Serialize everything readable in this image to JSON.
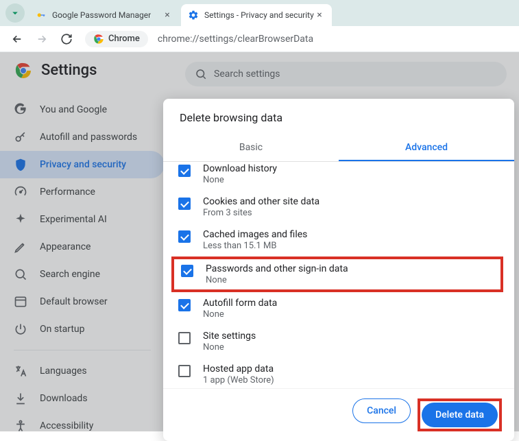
{
  "tabs": [
    {
      "title": "Google Password Manager"
    },
    {
      "title": "Settings - Privacy and security"
    }
  ],
  "addressBar": {
    "label": "Chrome",
    "url": "chrome://settings/clearBrowserData"
  },
  "settingsTitle": "Settings",
  "searchPlaceholder": "Search settings",
  "sidebar": [
    {
      "label": "You and Google"
    },
    {
      "label": "Autofill and passwords"
    },
    {
      "label": "Privacy and security"
    },
    {
      "label": "Performance"
    },
    {
      "label": "Experimental AI"
    },
    {
      "label": "Appearance"
    },
    {
      "label": "Search engine"
    },
    {
      "label": "Default browser"
    },
    {
      "label": "On startup"
    }
  ],
  "sidebarExtra": [
    {
      "label": "Languages"
    },
    {
      "label": "Downloads"
    },
    {
      "label": "Accessibility"
    }
  ],
  "dialog": {
    "title": "Delete browsing data",
    "tabs": {
      "basic": "Basic",
      "advanced": "Advanced"
    },
    "items": [
      {
        "label": "Download history",
        "sub": "None",
        "checked": true
      },
      {
        "label": "Cookies and other site data",
        "sub": "From 3 sites",
        "checked": true
      },
      {
        "label": "Cached images and files",
        "sub": "Less than 15.1 MB",
        "checked": true
      },
      {
        "label": "Passwords and other sign-in data",
        "sub": "None",
        "checked": true
      },
      {
        "label": "Autofill form data",
        "sub": "None",
        "checked": true
      },
      {
        "label": "Site settings",
        "sub": "None",
        "checked": false
      },
      {
        "label": "Hosted app data",
        "sub": "1 app (Web Store)",
        "checked": false
      }
    ],
    "cancel": "Cancel",
    "delete": "Delete data"
  }
}
